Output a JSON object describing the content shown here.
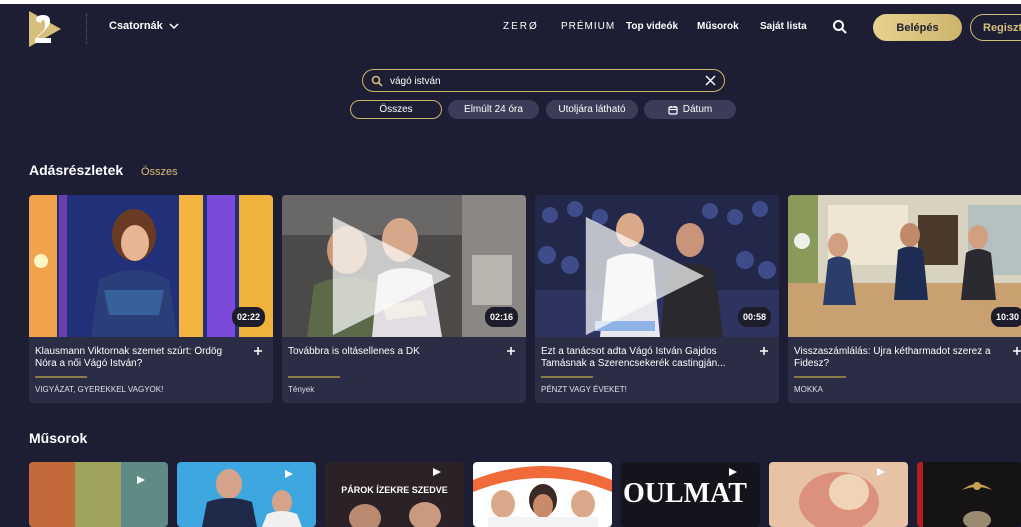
{
  "header": {
    "channels_label": "Csatornák",
    "nav": [
      "ZERØ",
      "PRÉMIUM",
      "Top videók",
      "Műsorok",
      "Saját lista"
    ],
    "login_label": "Belépés",
    "register_label": "Regisztráció"
  },
  "search": {
    "value": "vágó istván"
  },
  "filters": [
    "Összes",
    "Elmúlt 24 óra",
    "Utoljára látható",
    "Dátum"
  ],
  "episodes_section": {
    "title": "Adásrészletek",
    "see_all": "Összes",
    "cards": [
      {
        "title": "Klausmann Viktornak szemet szúrt: Ördög Nóra a női Vágó István?",
        "duration": "02:22",
        "show": "VIGYÁZAT, GYEREKKEL VAGYOK!"
      },
      {
        "title": "Továbbra is oltásellenes a DK",
        "duration": "02:16",
        "show": "Tények"
      },
      {
        "title": "Ezt a tanácsot adta Vágó István Gajdos Tamásnak a Szerencsekerék castingján...",
        "duration": "00:58",
        "show": "PÉNZT VAGY ÉVEKET!"
      },
      {
        "title": "Visszaszámlálás: Újra kétharmadot szerez a Fidesz?",
        "duration": "10:30",
        "show": "MOKKA"
      }
    ]
  },
  "shows_section": {
    "title": "Műsorok",
    "tile_captions": [
      "PÁROK ÍZEKRE SZEDVE",
      "OULMAT"
    ]
  },
  "colors": {
    "background": "#1d1e33",
    "card": "#2b2d45",
    "accent_gold": "#cdb46c"
  }
}
